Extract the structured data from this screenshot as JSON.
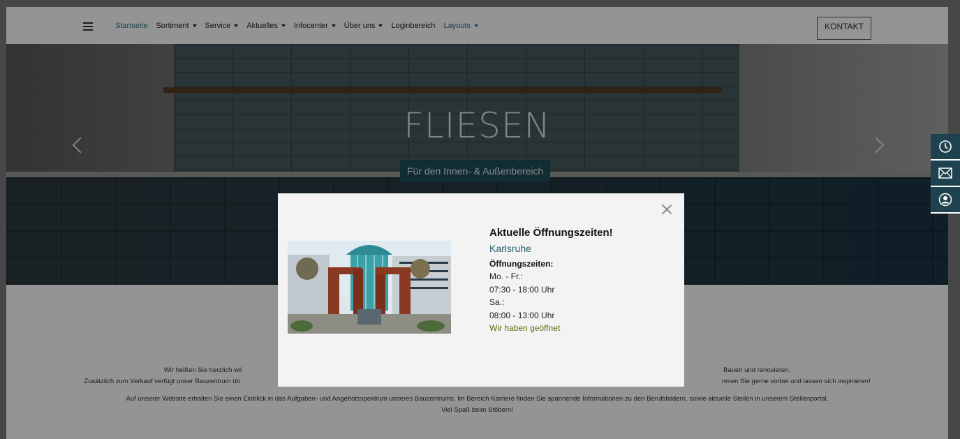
{
  "nav": {
    "items": [
      {
        "label": "Startseite",
        "caret": false,
        "color": "#2f6e86"
      },
      {
        "label": "Sortiment",
        "caret": true,
        "color": "#222222"
      },
      {
        "label": "Service",
        "caret": true,
        "color": "#222222"
      },
      {
        "label": "Aktuelles",
        "caret": true,
        "color": "#222222"
      },
      {
        "label": "Infocenter",
        "caret": true,
        "color": "#222222"
      },
      {
        "label": "Über uns",
        "caret": true,
        "color": "#222222"
      },
      {
        "label": "Loginbereich",
        "caret": false,
        "color": "#222222"
      },
      {
        "label": "Layouts",
        "caret": true,
        "color": "#2f6e86"
      }
    ],
    "contact_label": "KONTAKT"
  },
  "hero": {
    "title": "FLIESEN",
    "subtitle": "Für den Innen- & Außenbereich"
  },
  "side_tabs": [
    "clock-icon",
    "mail-icon",
    "user-icon"
  ],
  "body": {
    "line1a": "Wir heißen Sie herzlich wil",
    "line1b": "Bauen und renovieren.",
    "line2a": "Zusätzlich zum Verkauf verfügt unser Bauzentrum üb",
    "line2b": "nmen Sie gerne vorbei und lassen sich inspirieren!",
    "line3": "Auf unserer Website erhalten Sie einen Einblick in das Aufgaben- und Angebotsspektrum unseres Bauzentrums. Im Bereich Karriere finden Sie spannende Informationen zu den Berufsbildern, sowie aktuelle Stellen in unserem Stellenportal.",
    "line4": "Viel Spaß beim Stöbern!"
  },
  "modal": {
    "title": "Aktuelle Öffnungszeiten!",
    "city": "Karlsruhe",
    "hours_label": "Öffnungszeiten:",
    "weekday_label": "Mo. - Fr.:",
    "weekday_hours": "07:30 - 18:00 Uhr",
    "saturday_label": "Sa.:",
    "saturday_hours": "08:00 - 13:00 Uhr",
    "status": "Wir haben geöffnet",
    "status_color": "#5a6b12"
  }
}
